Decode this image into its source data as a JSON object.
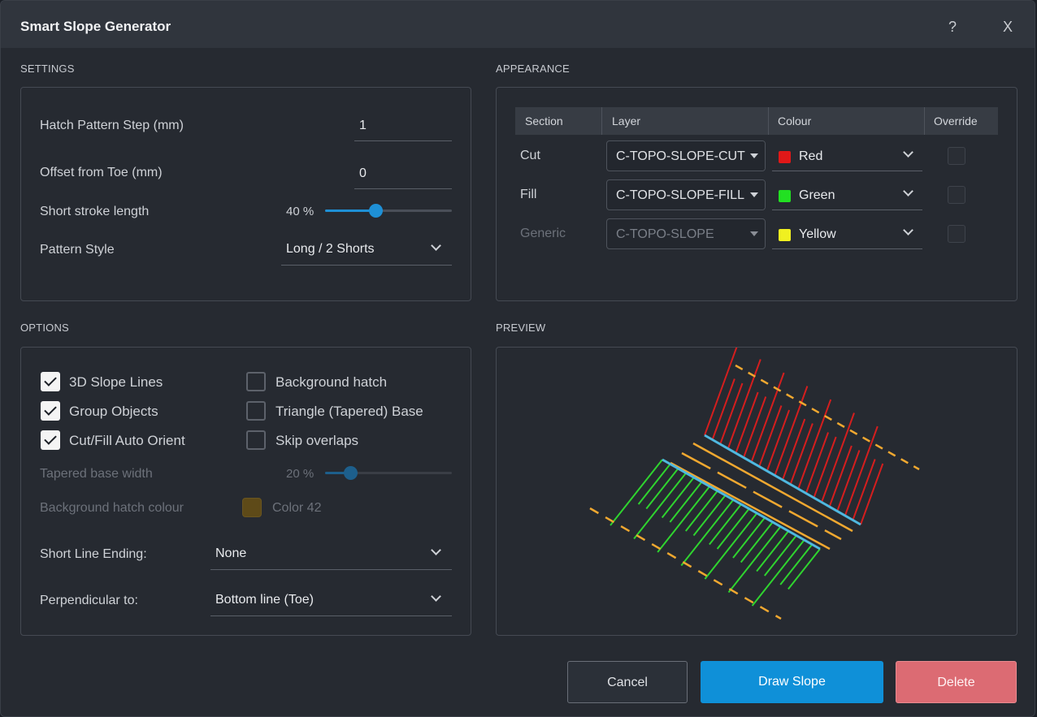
{
  "window": {
    "title": "Smart Slope Generator",
    "help": "?",
    "close": "X"
  },
  "settings": {
    "heading": "SETTINGS",
    "hatch_step_label": "Hatch Pattern Step (mm)",
    "hatch_step_value": "1",
    "offset_label": "Offset from Toe (mm)",
    "offset_value": "0",
    "short_stroke_label": "Short stroke length",
    "short_stroke_value": "40 %",
    "short_stroke_fraction": 0.4,
    "pattern_style_label": "Pattern Style",
    "pattern_style_value": "Long / 2 Shorts"
  },
  "appearance": {
    "heading": "APPEARANCE",
    "columns": [
      "Section",
      "Layer",
      "Colour",
      "Override"
    ],
    "rows": [
      {
        "section": "Cut",
        "layer": "C-TOPO-SLOPE-CUT",
        "colour": "Red",
        "swatch": "#e01818",
        "override": false,
        "enabled": true
      },
      {
        "section": "Fill",
        "layer": "C-TOPO-SLOPE-FILL",
        "colour": "Green",
        "swatch": "#22e022",
        "override": false,
        "enabled": true
      },
      {
        "section": "Generic",
        "layer": "C-TOPO-SLOPE",
        "colour": "Yellow",
        "swatch": "#f0f020",
        "override": false,
        "enabled": false
      }
    ]
  },
  "options": {
    "heading": "OPTIONS",
    "checkboxes": [
      {
        "label": "3D Slope Lines",
        "checked": true
      },
      {
        "label": "Group Objects",
        "checked": true
      },
      {
        "label": "Cut/Fill Auto Orient",
        "checked": true
      },
      {
        "label": "Background hatch",
        "checked": false
      },
      {
        "label": "Triangle (Tapered) Base",
        "checked": false
      },
      {
        "label": "Skip overlaps",
        "checked": false
      }
    ],
    "tapered_label": "Tapered base width",
    "tapered_value": "20 %",
    "tapered_fraction": 0.2,
    "bg_colour_label": "Background hatch colour",
    "bg_colour_value": "Color 42",
    "short_line_ending_label": "Short Line Ending:",
    "short_line_ending_value": "None",
    "perpendicular_label": "Perpendicular to:",
    "perpendicular_value": "Bottom line (Toe)"
  },
  "preview": {
    "heading": "PREVIEW"
  },
  "buttons": {
    "cancel": "Cancel",
    "draw": "Draw Slope",
    "delete": "Delete"
  },
  "colors": {
    "accent": "#0f90d8",
    "delete": "#dc6b73",
    "cut": "#d41e1e",
    "fill": "#2fd42f",
    "toe": "#4fb8e0",
    "dash": "#f0a830"
  }
}
